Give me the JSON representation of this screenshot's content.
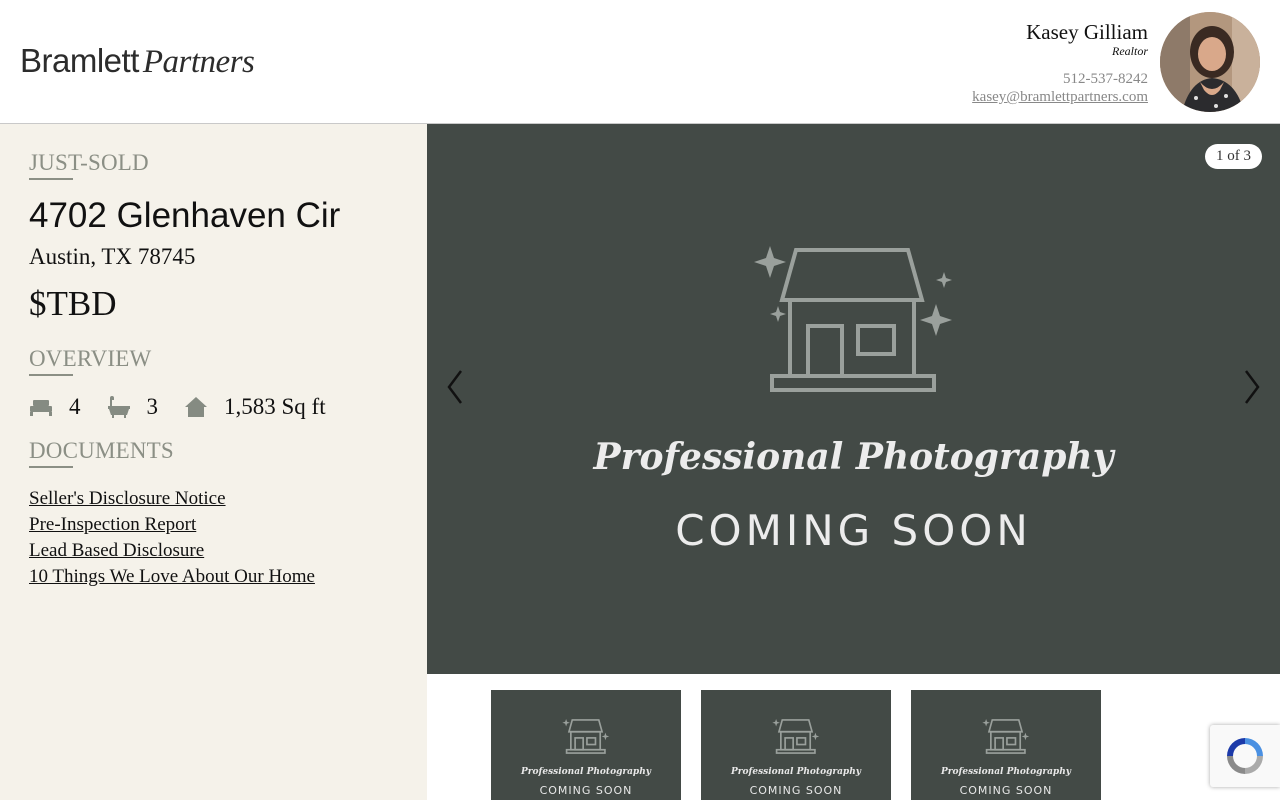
{
  "header": {
    "logo_part1": "Bramlett",
    "logo_part2": "Partners",
    "agent_name": "Kasey Gilliam",
    "agent_role": "Realtor",
    "agent_phone": "512-537-8242",
    "agent_email": "kasey@bramlettpartners.com"
  },
  "listing": {
    "status": "JUST-SOLD",
    "address_line1": "4702 Glenhaven Cir",
    "address_line2": "Austin, TX 78745",
    "price": "$TBD",
    "overview_label": "OVERVIEW",
    "beds": "4",
    "baths": "3",
    "sqft": "1,583 Sq ft",
    "documents_label": "DOCUMENTS",
    "documents": [
      "Seller's Disclosure Notice",
      "Pre-Inspection Report",
      "Lead Based Disclosure",
      "10 Things We Love About Our Home"
    ]
  },
  "gallery": {
    "counter": "1 of 3",
    "placeholder_title": "Professional Photography",
    "placeholder_sub": "COMING SOON",
    "thumbnails": [
      {
        "title": "Professional Photography",
        "sub": "COMING SOON"
      },
      {
        "title": "Professional Photography",
        "sub": "COMING SOON"
      },
      {
        "title": "Professional Photography",
        "sub": "COMING SOON"
      }
    ]
  },
  "colors": {
    "panel_bg": "#f5f2ea",
    "gallery_bg": "#434a46",
    "label_gray": "#8b8f85"
  },
  "icons": {
    "beds": "bed-icon",
    "baths": "bathtub-icon",
    "sqft": "house-icon",
    "prev": "chevron-left-icon",
    "next": "chevron-right-icon"
  }
}
